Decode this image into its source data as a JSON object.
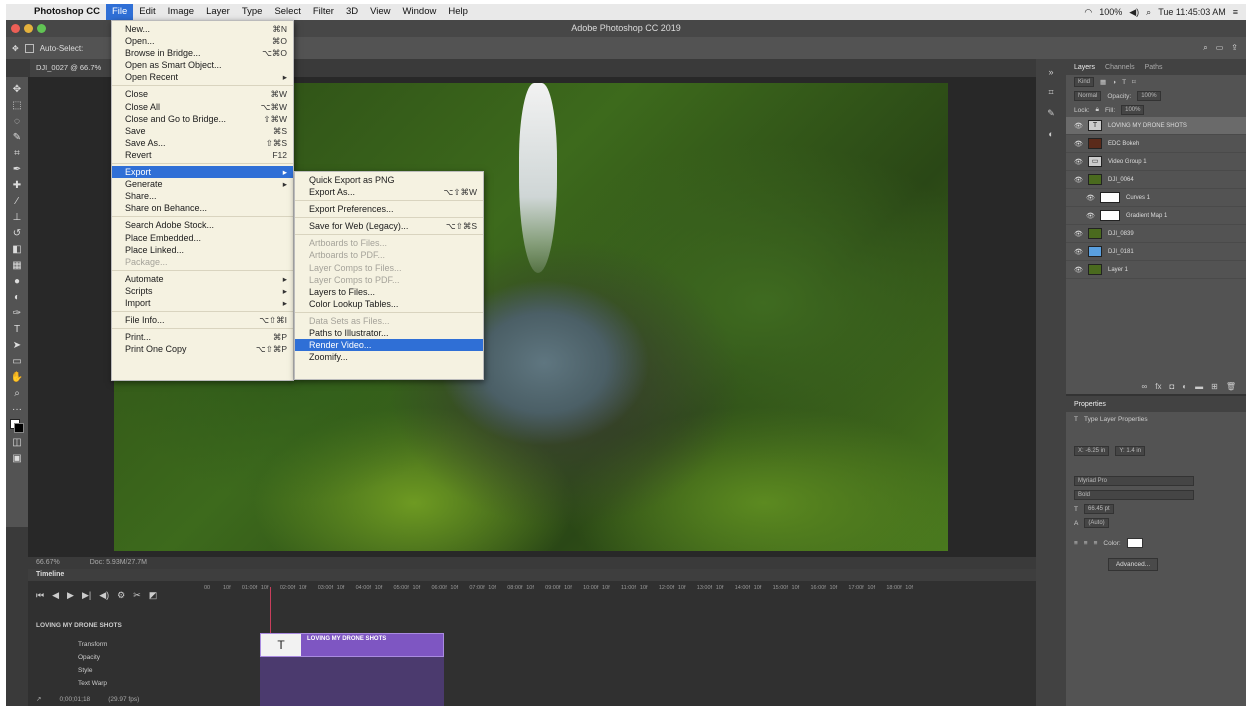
{
  "mac_menubar": {
    "items": [
      "Photoshop CC",
      "File",
      "Edit",
      "Image",
      "Layer",
      "Type",
      "Select",
      "Filter",
      "3D",
      "View",
      "Window",
      "Help"
    ],
    "battery": "100%",
    "clock": "Tue 11:45:03 AM"
  },
  "window": {
    "title": "Adobe Photoshop CC 2019"
  },
  "options_bar": {
    "auto_select": "Auto-Select:"
  },
  "document": {
    "tab": "DJI_0027 @ 66.7%",
    "zoom": "66.67%",
    "doc_size": "Doc: 5.93M/27.7M"
  },
  "file_menu": {
    "groups": [
      [
        {
          "label": "New...",
          "sc": "⌘N"
        },
        {
          "label": "Open...",
          "sc": "⌘O"
        },
        {
          "label": "Browse in Bridge...",
          "sc": "⌥⌘O"
        },
        {
          "label": "Open as Smart Object...",
          "sc": ""
        },
        {
          "label": "Open Recent",
          "sc": "▸"
        }
      ],
      [
        {
          "label": "Close",
          "sc": "⌘W"
        },
        {
          "label": "Close All",
          "sc": "⌥⌘W"
        },
        {
          "label": "Close and Go to Bridge...",
          "sc": "⇧⌘W"
        },
        {
          "label": "Save",
          "sc": "⌘S"
        },
        {
          "label": "Save As...",
          "sc": "⇧⌘S"
        },
        {
          "label": "Revert",
          "sc": "F12"
        }
      ],
      [
        {
          "label": "Export",
          "sc": "▸",
          "hi": true
        },
        {
          "label": "Generate",
          "sc": "▸"
        },
        {
          "label": "Share...",
          "sc": ""
        },
        {
          "label": "Share on Behance...",
          "sc": ""
        }
      ],
      [
        {
          "label": "Search Adobe Stock...",
          "sc": ""
        },
        {
          "label": "Place Embedded...",
          "sc": ""
        },
        {
          "label": "Place Linked...",
          "sc": ""
        },
        {
          "label": "Package...",
          "sc": "",
          "dis": true
        }
      ],
      [
        {
          "label": "Automate",
          "sc": "▸"
        },
        {
          "label": "Scripts",
          "sc": "▸"
        },
        {
          "label": "Import",
          "sc": "▸"
        }
      ],
      [
        {
          "label": "File Info...",
          "sc": "⌥⇧⌘I"
        }
      ],
      [
        {
          "label": "Print...",
          "sc": "⌘P"
        },
        {
          "label": "Print One Copy",
          "sc": "⌥⇧⌘P"
        }
      ]
    ]
  },
  "export_menu": {
    "groups": [
      [
        {
          "label": "Quick Export as PNG",
          "sc": ""
        },
        {
          "label": "Export As...",
          "sc": "⌥⇧⌘W"
        }
      ],
      [
        {
          "label": "Export Preferences...",
          "sc": ""
        }
      ],
      [
        {
          "label": "Save for Web (Legacy)...",
          "sc": "⌥⇧⌘S"
        }
      ],
      [
        {
          "label": "Artboards to Files...",
          "sc": "",
          "dis": true
        },
        {
          "label": "Artboards to PDF...",
          "sc": "",
          "dis": true
        },
        {
          "label": "Layer Comps to Files...",
          "sc": "",
          "dis": true
        },
        {
          "label": "Layer Comps to PDF...",
          "sc": "",
          "dis": true
        },
        {
          "label": "Layers to Files...",
          "sc": ""
        },
        {
          "label": "Color Lookup Tables...",
          "sc": ""
        }
      ],
      [
        {
          "label": "Data Sets as Files...",
          "sc": "",
          "dis": true
        },
        {
          "label": "Paths to Illustrator...",
          "sc": ""
        },
        {
          "label": "Render Video...",
          "sc": "",
          "hi": true
        },
        {
          "label": "Zoomify...",
          "sc": ""
        }
      ]
    ]
  },
  "layers_panel": {
    "tabs": [
      "Layers",
      "Channels",
      "Paths"
    ],
    "kind": "Kind",
    "blend": "Normal",
    "opacity_label": "Opacity:",
    "opacity": "100%",
    "lock_label": "Lock:",
    "fill_label": "Fill:",
    "fill": "100%",
    "layers": [
      {
        "name": "LOVING MY DRONE SHOTS",
        "thumb": "T",
        "kind": "text",
        "sel": true
      },
      {
        "name": "EDC Bokeh",
        "thumb": "",
        "kind": "dark"
      },
      {
        "name": "Video Group 1",
        "thumb": "▭",
        "kind": "group"
      },
      {
        "name": "DJI_0064",
        "thumb": "",
        "kind": "green"
      },
      {
        "name": "Curves 1",
        "thumb": "",
        "kind": "mask"
      },
      {
        "name": "Gradient Map 1",
        "thumb": "",
        "kind": "mask"
      },
      {
        "name": "DJI_0839",
        "thumb": "",
        "kind": "green"
      },
      {
        "name": "DJI_0181",
        "thumb": "",
        "kind": "blue"
      },
      {
        "name": "Layer 1",
        "thumb": "",
        "kind": "green"
      }
    ]
  },
  "properties_panel": {
    "title": "Properties",
    "subtitle": "Type Layer Properties",
    "x": "X: -6.25 in",
    "y": "Y: 1.4 in",
    "font": "Myriad Pro",
    "style": "Bold",
    "size": "66.45 pt",
    "leading": "(Auto)",
    "color_label": "Color:",
    "advanced": "Advanced..."
  },
  "timeline": {
    "title": "Timeline",
    "ruler": [
      "00",
      "10f",
      "01:00f",
      "10f",
      "02:00f",
      "10f",
      "03:00f",
      "10f",
      "04:00f",
      "10f",
      "05:00f",
      "10f",
      "06:00f",
      "10f",
      "07:00f",
      "10f",
      "08:00f",
      "10f",
      "09:00f",
      "10f",
      "10:00f",
      "10f",
      "11:00f",
      "10f",
      "12:00f",
      "10f",
      "13:00f",
      "10f",
      "14:00f",
      "10f",
      "15:00f",
      "10f",
      "16:00f",
      "10f",
      "17:00f",
      "10f",
      "18:00f",
      "10f"
    ],
    "track": "LOVING MY DRONE SHOTS",
    "props": [
      "Transform",
      "Opacity",
      "Style",
      "Text Warp"
    ],
    "clip_label": "LOVING MY DRONE SHOTS",
    "timecode": "0;00;01;18",
    "fps": "(29.97 fps)"
  }
}
